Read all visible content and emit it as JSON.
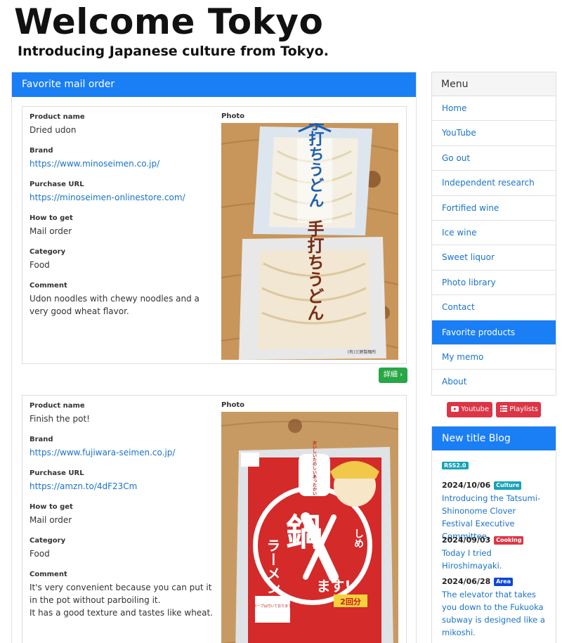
{
  "header": {
    "title": "Welcome Tokyo",
    "subtitle": "Introducing Japanese culture from Tokyo."
  },
  "main": {
    "section_title": "Favorite mail order",
    "labels": {
      "product_name": "Product name",
      "brand": "Brand",
      "purchase_url": "Purchase URL",
      "how_to_get": "How to get",
      "category": "Category",
      "comment": "Comment",
      "photo": "Photo"
    },
    "detail_button": "詳細 ›",
    "products": [
      {
        "name": "Dried udon",
        "brand": "https://www.minoseimen.co.jp/",
        "purchase_url": "https://minoseimen-onlinestore.com/",
        "how_to_get": "Mail order",
        "category": "Food",
        "comment_lines": [
          "Udon noodles with chewy noodles and a very good wheat flavor."
        ],
        "photo_text": {
          "top": "手打ちうどん",
          "bottom": "手打ちうどん",
          "maker": "(有)三野製麺所"
        }
      },
      {
        "name": "Finish the pot!",
        "brand": "https://www.fujiwara-seimen.co.jp/",
        "purchase_url": "https://amzn.to/4dF23Cm",
        "how_to_get": "Mail order",
        "category": "Food",
        "comment_lines": [
          "It's very convenient because you can put it in the pot without parboiling it.",
          "It has a good texture and tastes like wheat."
        ],
        "photo_text": {
          "main": "鍋",
          "shime": "しめ",
          "masu": "ます!",
          "ramen": "ラーメン",
          "servings": "2回分",
          "soup": "スープは付いております",
          "bubble": "おいしいたのしいあったかい"
        }
      }
    ]
  },
  "sidebar": {
    "menu_title": "Menu",
    "menu_items": [
      {
        "label": "Home",
        "active": false
      },
      {
        "label": "YouTube",
        "active": false
      },
      {
        "label": "Go out",
        "active": false
      },
      {
        "label": "Independent research",
        "active": false
      },
      {
        "label": "Fortified wine",
        "active": false
      },
      {
        "label": "Ice wine",
        "active": false
      },
      {
        "label": "Sweet liquor",
        "active": false
      },
      {
        "label": "Photo library",
        "active": false
      },
      {
        "label": "Contact",
        "active": false
      },
      {
        "label": "Favorite products",
        "active": true
      },
      {
        "label": "My memo",
        "active": false
      },
      {
        "label": "About",
        "active": false
      }
    ],
    "youtube_button": "Youtube",
    "playlists_button": "Playlists",
    "blog_title": "New title Blog",
    "rss_label": "RSS2.0",
    "blog_entries": [
      {
        "date": "2024/10/06",
        "badge": "Culture",
        "badge_color": "#17a2b8",
        "title": "Introducing the Tatsumi-Shinonome Clover Festival Executive Committee."
      },
      {
        "date": "2024/09/03",
        "badge": "Cooking",
        "badge_color": "#dc3545",
        "title": "Today I tried Hiroshimayaki."
      },
      {
        "date": "2024/06/28",
        "badge": "Area",
        "badge_color": "#0d47d9",
        "title": "The elevator that takes you down to the Fukuoka subway is designed like a mikoshi."
      }
    ]
  },
  "colors": {
    "primary": "#1a7ef5",
    "link": "#1a73c9",
    "success": "#28a745",
    "danger": "#dc3545"
  }
}
